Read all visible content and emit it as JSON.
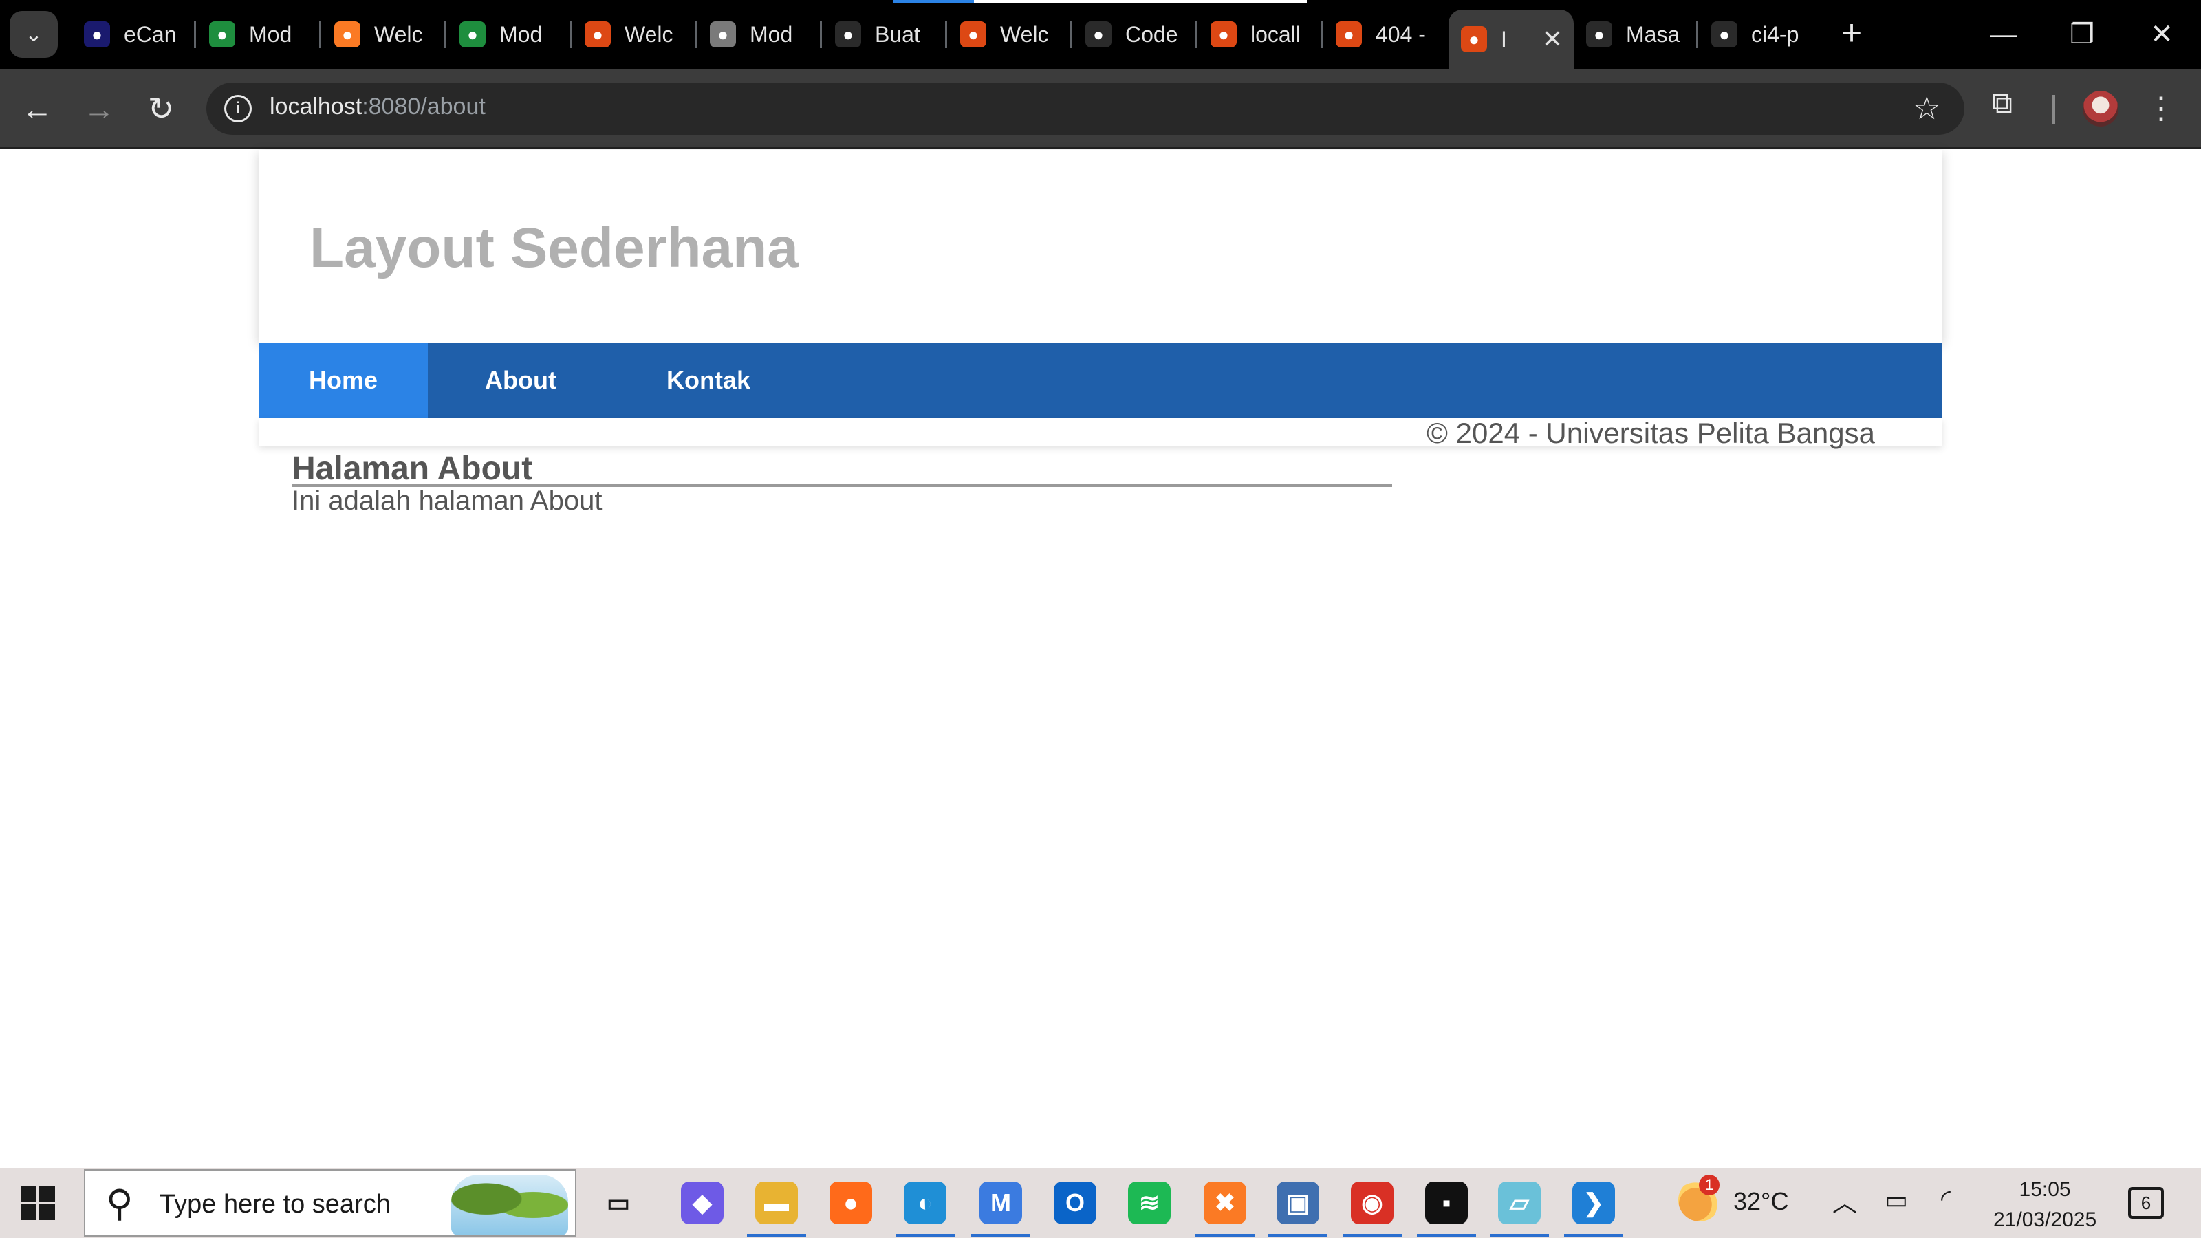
{
  "browser": {
    "tabs": [
      {
        "title": "eCan",
        "icon": "ecan-favicon",
        "color": "#1a1a6e"
      },
      {
        "title": "Mod",
        "icon": "google-drive-favicon",
        "color": "#1e8e3e"
      },
      {
        "title": "Welc",
        "icon": "xampp-favicon",
        "color": "#fb7a24"
      },
      {
        "title": "Mod",
        "icon": "google-drive-favicon",
        "color": "#1e8e3e"
      },
      {
        "title": "Welc",
        "icon": "codeigniter-flame-favicon",
        "color": "#dd4814"
      },
      {
        "title": "Mod",
        "icon": "globe-favicon",
        "color": "#7a7a7a"
      },
      {
        "title": "Buat",
        "icon": "chatgpt-favicon",
        "color": "#2a2a2a"
      },
      {
        "title": "Welc",
        "icon": "codeigniter-flame-favicon",
        "color": "#dd4814"
      },
      {
        "title": "Code",
        "icon": "chatgpt-favicon",
        "color": "#2a2a2a"
      },
      {
        "title": "locall",
        "icon": "codeigniter-flame-favicon",
        "color": "#dd4814"
      },
      {
        "title": "404 -",
        "icon": "codeigniter-flame-favicon",
        "color": "#dd4814"
      },
      {
        "title": "I",
        "icon": "codeigniter-flame-favicon",
        "color": "#dd4814",
        "active": true
      },
      {
        "title": "Masa",
        "icon": "chatgpt-favicon",
        "color": "#2a2a2a"
      },
      {
        "title": "ci4-p",
        "icon": "github-favicon",
        "color": "#2a2a2a"
      }
    ],
    "close_glyph": "✕",
    "new_tab_glyph": "+",
    "url_host": "localhost",
    "url_path": ":8080/about"
  },
  "page": {
    "site_title": "Layout Sederhana",
    "nav": [
      {
        "label": "Home",
        "active": true
      },
      {
        "label": "About",
        "active": false
      },
      {
        "label": "Kontak",
        "active": false
      }
    ],
    "footer": "© 2024 - Universitas Pelita Bangsa",
    "content_title": "Halaman About",
    "content_text": "Ini adalah halaman About"
  },
  "taskbar": {
    "search_placeholder": "Type here to search",
    "apps": [
      {
        "name": "task-view",
        "glyph": "▭",
        "color": "#e4dedd"
      },
      {
        "name": "copilot",
        "glyph": "◆",
        "color": "#6e5ae6"
      },
      {
        "name": "file-explorer",
        "glyph": "▬",
        "color": "#e8b332"
      },
      {
        "name": "firefox",
        "glyph": "●",
        "color": "#ff6a1a"
      },
      {
        "name": "edge",
        "glyph": "◐",
        "color": "#1f8fd6"
      },
      {
        "name": "m365",
        "glyph": "M",
        "color": "#3b7be0"
      },
      {
        "name": "outlook",
        "glyph": "O",
        "color": "#0a64c8"
      },
      {
        "name": "spotify",
        "glyph": "≋",
        "color": "#1db954"
      },
      {
        "name": "xampp",
        "glyph": "✖",
        "color": "#fb7a24"
      },
      {
        "name": "remote-desktop",
        "glyph": "▣",
        "color": "#3f6fb0"
      },
      {
        "name": "chrome",
        "glyph": "◉",
        "color": "#d93025"
      },
      {
        "name": "terminal",
        "glyph": "▪",
        "color": "#111111"
      },
      {
        "name": "notepad",
        "glyph": "▱",
        "color": "#6ac1d9"
      },
      {
        "name": "vscode",
        "glyph": "❯",
        "color": "#1f7fd6"
      }
    ],
    "weather_badge": "1",
    "temperature": "32°C",
    "time": "15:05",
    "date": "21/03/2025",
    "notifications": "6"
  }
}
